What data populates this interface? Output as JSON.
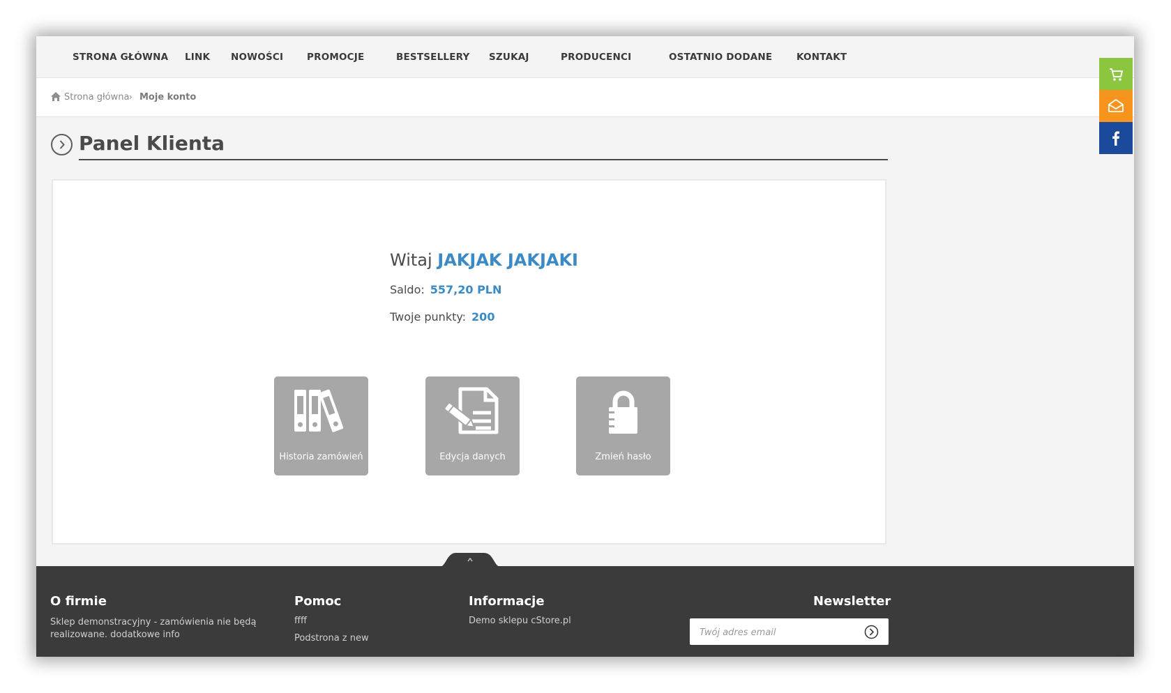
{
  "nav": {
    "items": [
      "STRONA GŁÓWNA",
      "LINK",
      "NOWOŚCI",
      "PROMOCJE",
      "BESTSELLERY",
      "SZUKAJ",
      "PRODUCENCI",
      "OSTATNIO DODANE",
      "KONTAKT"
    ]
  },
  "breadcrumb": {
    "home": "Strona główna",
    "separator": "›",
    "current": "Moje konto"
  },
  "page": {
    "title": "Panel Klienta"
  },
  "account": {
    "greeting": "Witaj",
    "name": "JAKJAK JAKJAKI",
    "balance_label": "Saldo:",
    "balance_value": "557,20 PLN",
    "points_label": "Twoje punkty:",
    "points_value": "200"
  },
  "tiles": [
    {
      "label": "Historia zamówień",
      "icon": "binders-icon"
    },
    {
      "label": "Edycja danych",
      "icon": "document-pen-icon"
    },
    {
      "label": "Zmień hasło",
      "icon": "padlock-icon"
    }
  ],
  "footer": {
    "about_heading": "O firmie",
    "about_text_1": "Sklep demonstracyjny - zamówienia nie będą",
    "about_text_2": "realizowane. dodatkowe info",
    "help_heading": "Pomoc",
    "help_links": [
      "ffff",
      "Podstrona z new"
    ],
    "info_heading": "Informacje",
    "info_links": [
      "Demo sklepu cStore.pl"
    ],
    "newsletter_heading": "Newsletter",
    "newsletter_placeholder": "Twój adres email"
  },
  "side_buttons": [
    {
      "icon": "cart-icon",
      "color": "#8cc63f"
    },
    {
      "icon": "envelope-icon",
      "color": "#f7941d"
    },
    {
      "icon": "facebook-icon",
      "color": "#1b4a9c"
    }
  ],
  "colors": {
    "accent": "#3b8ac6",
    "tile": "#a7a7a7",
    "footer": "#3b3b3b"
  }
}
